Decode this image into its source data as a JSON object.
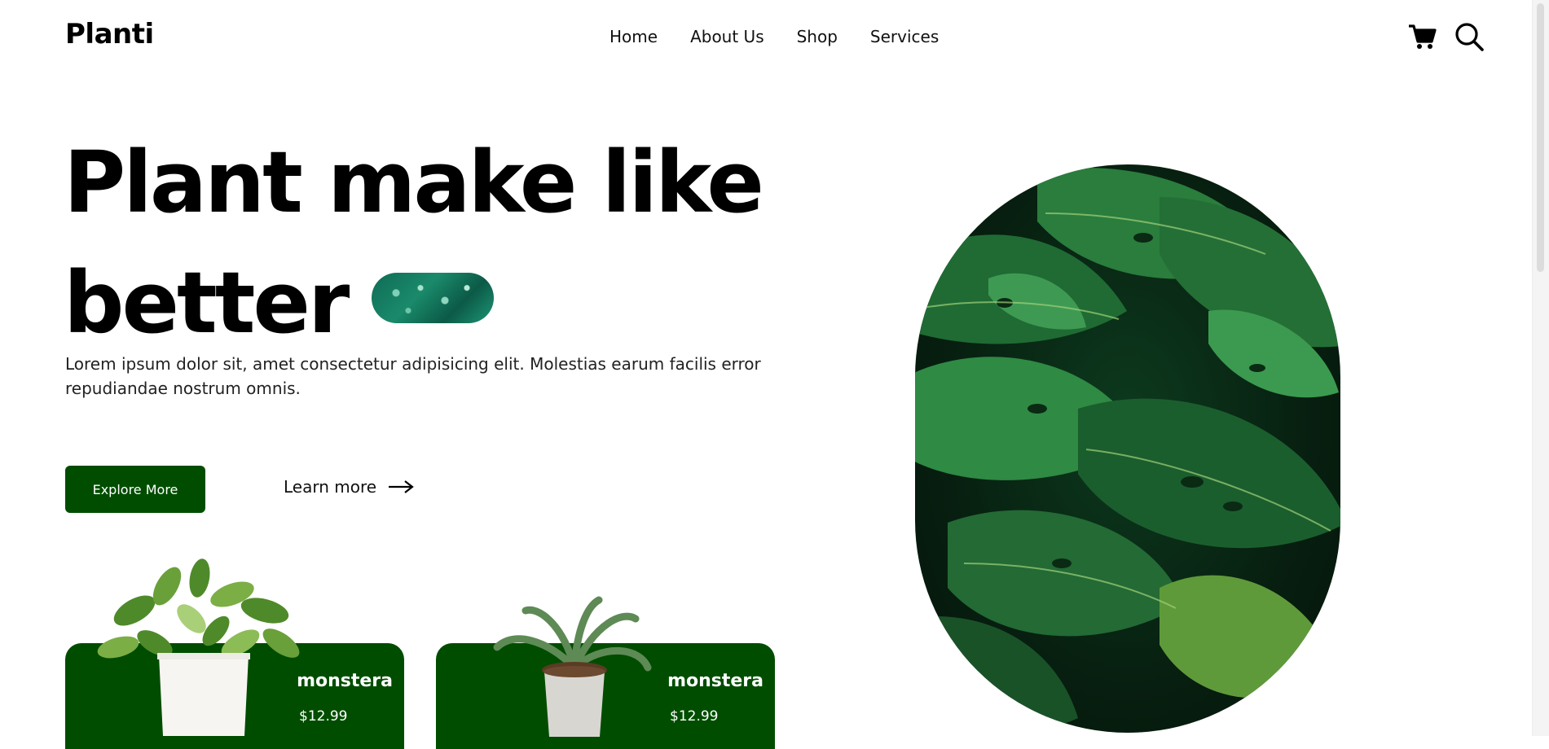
{
  "header": {
    "logo": "Planti",
    "nav": [
      "Home",
      "About Us",
      "Shop",
      "Services"
    ],
    "icons": [
      "cart-icon",
      "search-icon"
    ]
  },
  "hero": {
    "title_line1": "Plant make like",
    "title_line2": "better",
    "description": "Lorem ipsum dolor sit, amet consectetur adipisicing elit. Molestias earum facilis error repudiandae nostrum omnis.",
    "primary_button": "Explore More",
    "secondary_link": "Learn more"
  },
  "products": [
    {
      "name": "monstera",
      "price": "$12.99"
    },
    {
      "name": "monstera",
      "price": "$12.99"
    }
  ],
  "colors": {
    "brand_green": "#004d00",
    "text": "#000000",
    "background": "#ffffff"
  }
}
